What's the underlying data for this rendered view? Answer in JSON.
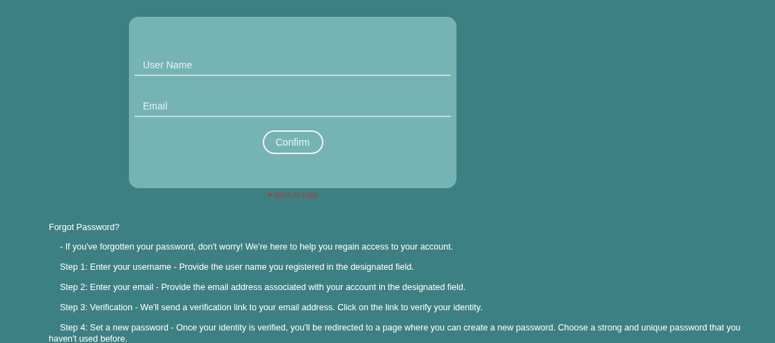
{
  "form": {
    "fields": [
      {
        "placeholder": "User Name"
      },
      {
        "placeholder": "Email"
      }
    ],
    "confirm_button": "Confirm",
    "back_link": "Back to login"
  },
  "help": {
    "title": "Forgot Password?",
    "paragraphs": [
      "- If you've forgotten your password, don't worry! We're here to help you regain access to your account.",
      "Step 1: Enter your username - Provide the user name you registered in the designated field.",
      "Step 2: Enter your email - Provide the email address associated with your account in the designated field.",
      "Step 3: Verification - We'll send a verification link to your email address. Click on the link to verify your identity.",
      "Step 4: Set a new password - Once your identity is verified, you'll be redirected to a page where you can create a new password. Choose a strong and unique password that you haven't used before."
    ]
  }
}
